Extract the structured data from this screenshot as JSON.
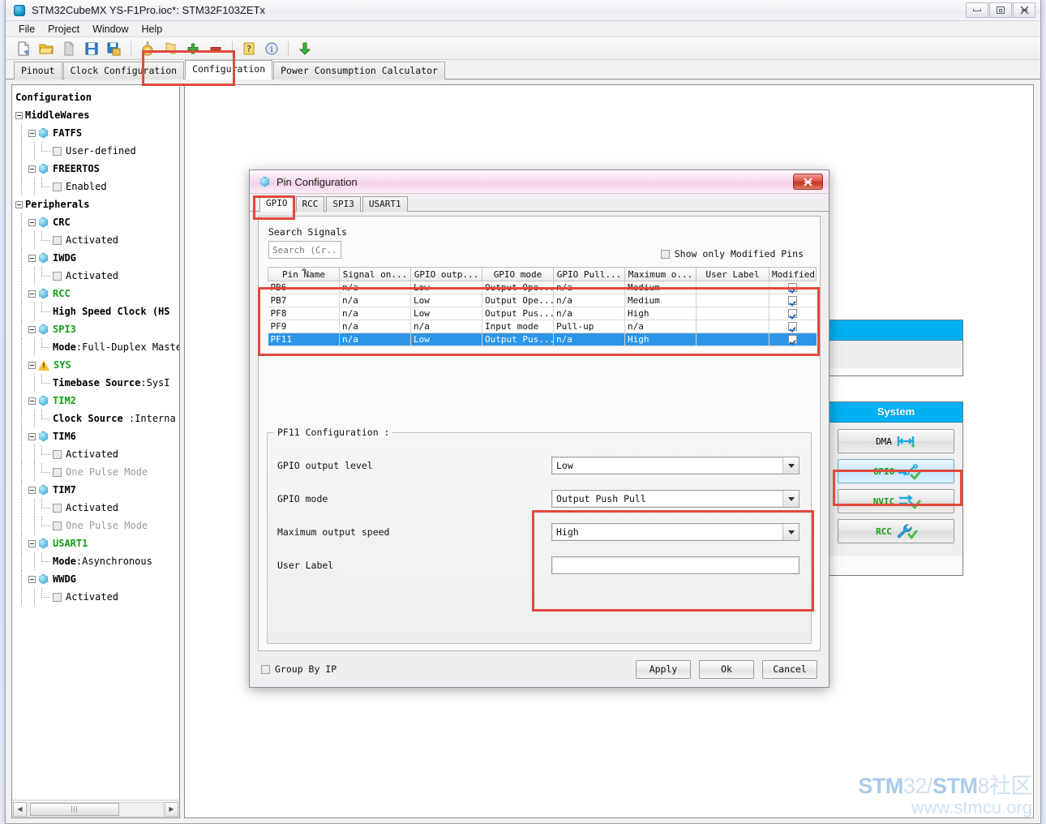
{
  "window": {
    "title": "STM32CubeMX YS-F1Pro.ioc*: STM32F103ZETx",
    "app_icon": "cube-icon",
    "minimize": "minimize-icon",
    "maximize": "maximize-icon",
    "close": "close-icon"
  },
  "menu": {
    "items": [
      "File",
      "Project",
      "Window",
      "Help"
    ]
  },
  "toolbar": {
    "icons": [
      "new-project-icon",
      "open-project-icon",
      "copy-icon",
      "save-icon",
      "save-as-icon",
      "generate-code-icon",
      "report-icon",
      "add-icon",
      "remove-icon",
      "help-icon",
      "about-icon",
      "update-icon"
    ]
  },
  "tabs": {
    "items": [
      {
        "label": "Pinout",
        "active": false
      },
      {
        "label": "Clock Configuration",
        "active": false
      },
      {
        "label": "Configuration",
        "active": true
      },
      {
        "label": "Power Consumption Calculator",
        "active": false
      }
    ]
  },
  "tree": {
    "root_label": "Configuration",
    "nodes": [
      {
        "indent": 0,
        "type": "group",
        "label": "MiddleWares",
        "style": "bold"
      },
      {
        "indent": 1,
        "type": "ip",
        "label": "FATFS",
        "style": "bold"
      },
      {
        "indent": 2,
        "type": "check",
        "label": "User-defined",
        "style": "normal"
      },
      {
        "indent": 1,
        "type": "ip",
        "label": "FREERTOS",
        "style": "bold"
      },
      {
        "indent": 2,
        "type": "check",
        "label": "Enabled",
        "style": "normal"
      },
      {
        "indent": 0,
        "type": "group",
        "label": "Peripherals",
        "style": "bold"
      },
      {
        "indent": 1,
        "type": "ip",
        "label": "CRC",
        "style": "bold"
      },
      {
        "indent": 2,
        "type": "check",
        "label": "Activated",
        "style": "normal"
      },
      {
        "indent": 1,
        "type": "ip",
        "label": "IWDG",
        "style": "bold"
      },
      {
        "indent": 2,
        "type": "check",
        "label": "Activated",
        "style": "normal"
      },
      {
        "indent": 1,
        "type": "ip",
        "label": "RCC",
        "style": "green"
      },
      {
        "indent": 2,
        "type": "kv",
        "key": "High Speed Clock (HS",
        "value": "",
        "style": "bold"
      },
      {
        "indent": 1,
        "type": "ip",
        "label": "SPI3",
        "style": "green"
      },
      {
        "indent": 2,
        "type": "kv",
        "key": "Mode",
        "value": ":Full-Duplex Maste",
        "style": "bold"
      },
      {
        "indent": 1,
        "type": "warn",
        "label": "SYS",
        "style": "green"
      },
      {
        "indent": 2,
        "type": "kv",
        "key": "Timebase Source",
        "value": ":SysI",
        "style": "bold"
      },
      {
        "indent": 1,
        "type": "ip",
        "label": "TIM2",
        "style": "green"
      },
      {
        "indent": 2,
        "type": "kv",
        "key": "Clock Source ",
        "value": ":Interna",
        "style": "bold"
      },
      {
        "indent": 1,
        "type": "ip",
        "label": "TIM6",
        "style": "bold"
      },
      {
        "indent": 2,
        "type": "check",
        "label": "Activated",
        "style": "normal"
      },
      {
        "indent": 2,
        "type": "check",
        "label": "One Pulse Mode",
        "style": "grey"
      },
      {
        "indent": 1,
        "type": "ip",
        "label": "TIM7",
        "style": "bold"
      },
      {
        "indent": 2,
        "type": "check",
        "label": "Activated",
        "style": "normal"
      },
      {
        "indent": 2,
        "type": "check",
        "label": "One Pulse Mode",
        "style": "grey"
      },
      {
        "indent": 1,
        "type": "ip",
        "label": "USART1",
        "style": "green"
      },
      {
        "indent": 2,
        "type": "kv",
        "key": "Mode",
        "value": ":Asynchronous",
        "style": "bold"
      },
      {
        "indent": 1,
        "type": "ip",
        "label": "WWDG",
        "style": "bold"
      },
      {
        "indent": 2,
        "type": "check",
        "label": "Activated",
        "style": "normal"
      }
    ],
    "hscroll": {
      "left_arrow": "scroll-left-icon",
      "right_arrow": "scroll-right-icon",
      "grip": "|||"
    }
  },
  "right_panels": [
    {
      "name": "partial-panel",
      "header": "",
      "buttons": []
    },
    {
      "name": "system-panel",
      "header": "System",
      "buttons": [
        {
          "label": "DMA",
          "icon": "dma-arrows-icon",
          "selected": false,
          "check": false
        },
        {
          "label": "GPIO",
          "icon": "gpio-switch-icon",
          "selected": true,
          "check": true,
          "label_color": "#12a112"
        },
        {
          "label": "NVIC",
          "icon": "nvic-arrows-icon",
          "selected": false,
          "check": true,
          "label_color": "#12a112"
        },
        {
          "label": "RCC",
          "icon": "rcc-wrench-icon",
          "selected": false,
          "check": true,
          "label_color": "#12a112"
        }
      ]
    }
  ],
  "dialog": {
    "title": "Pin Configuration",
    "icon": "cube-icon",
    "close_label": "✕",
    "tabs": [
      {
        "label": "GPIO",
        "active": true
      },
      {
        "label": "RCC",
        "active": false
      },
      {
        "label": "SPI3",
        "active": false
      },
      {
        "label": "USART1",
        "active": false
      }
    ],
    "search": {
      "label": "Search Signals",
      "placeholder": "Search (Cr...",
      "value": ""
    },
    "show_modified": {
      "label": "Show only Modified Pins",
      "checked": false
    },
    "table": {
      "columns": [
        "Pin Name",
        "Signal on...",
        "GPIO outp...",
        "GPIO mode",
        "GPIO Pull...",
        "Maximum o...",
        "User Label",
        "Modified"
      ],
      "sorted_column": 0,
      "rows": [
        {
          "cells": [
            "PB6",
            "n/a",
            "Low",
            "Output Ope...",
            "n/a",
            "Medium",
            ""
          ],
          "modified": true,
          "selected": false
        },
        {
          "cells": [
            "PB7",
            "n/a",
            "Low",
            "Output Ope...",
            "n/a",
            "Medium",
            ""
          ],
          "modified": true,
          "selected": false
        },
        {
          "cells": [
            "PF8",
            "n/a",
            "Low",
            "Output Pus...",
            "n/a",
            "High",
            ""
          ],
          "modified": true,
          "selected": false
        },
        {
          "cells": [
            "PF9",
            "n/a",
            "n/a",
            "Input mode",
            "Pull-up",
            "n/a",
            ""
          ],
          "modified": true,
          "selected": false
        },
        {
          "cells": [
            "PF11",
            "n/a",
            "Low",
            "Output Pus...",
            "n/a",
            "High",
            ""
          ],
          "modified": true,
          "selected": true
        }
      ]
    },
    "pin_config": {
      "legend": "PF11 Configuration :",
      "fields": [
        {
          "label": "GPIO output level",
          "type": "combo",
          "value": "Low"
        },
        {
          "label": "GPIO mode",
          "type": "combo",
          "value": "Output Push Pull"
        },
        {
          "label": "Maximum output speed",
          "type": "combo",
          "value": "High"
        },
        {
          "label": "User Label",
          "type": "text",
          "value": ""
        }
      ]
    },
    "footer": {
      "group_by_ip": {
        "label": "Group By IP",
        "checked": false
      },
      "buttons": [
        "Apply",
        "Ok",
        "Cancel"
      ]
    }
  },
  "watermark": {
    "line1_a": "STM",
    "line1_b": "32/",
    "line1_c": "STM",
    "line1_d": "8社区",
    "line2": "www.stmcu.org"
  },
  "colors": {
    "accent_cyan": "#00b0f0",
    "selection_blue": "#2c95e8",
    "highlight_red": "#e04a3c",
    "green_label": "#12a112"
  }
}
